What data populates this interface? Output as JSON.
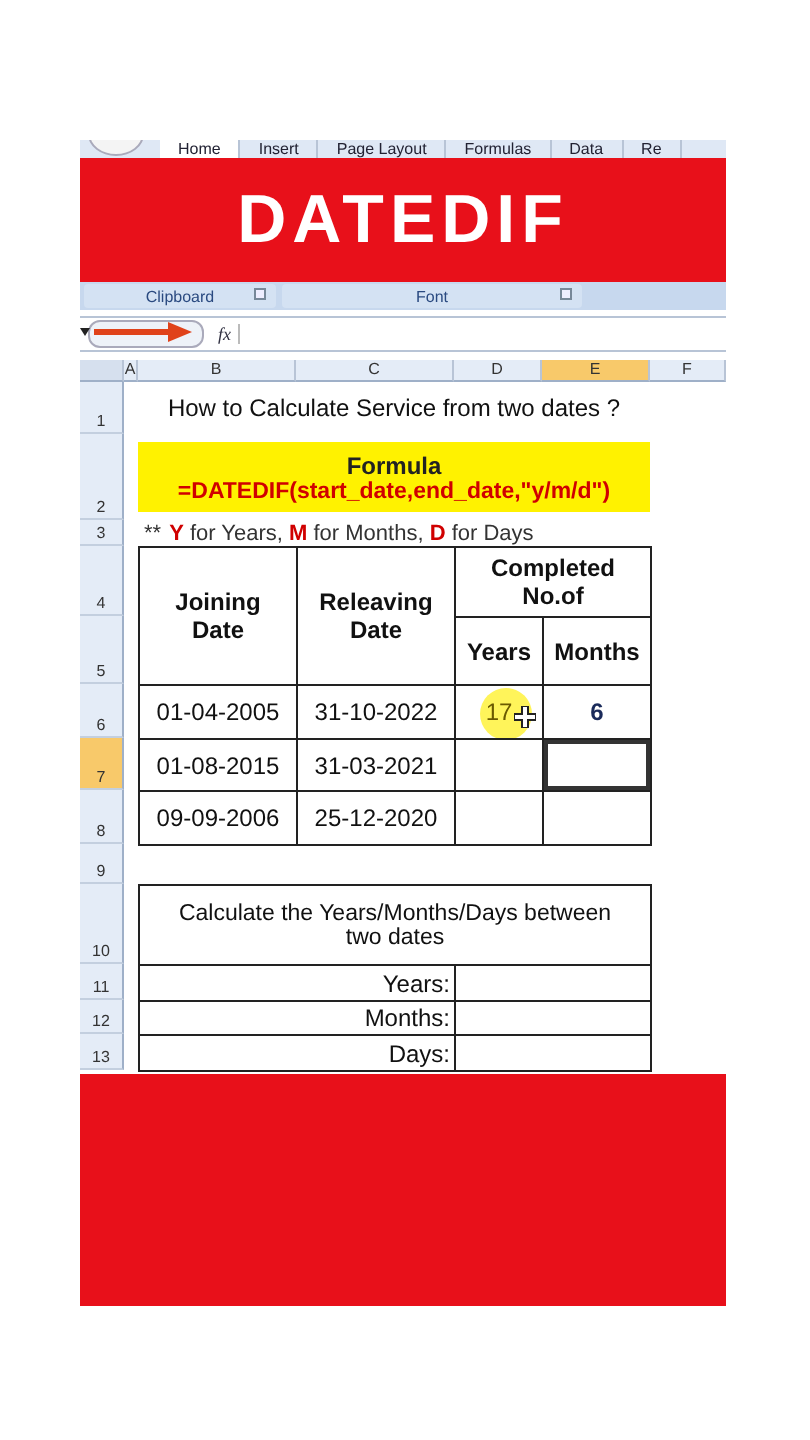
{
  "ribbon_tabs": [
    {
      "label": "Home",
      "selected": true
    },
    {
      "label": "Insert",
      "selected": false
    },
    {
      "label": "Page Layout",
      "selected": false
    },
    {
      "label": "Formulas",
      "selected": false
    },
    {
      "label": "Data",
      "selected": false
    },
    {
      "label": "Re",
      "selected": false
    }
  ],
  "banner": {
    "title": "DATEDIF"
  },
  "ribbon_groups": [
    "Clipboard",
    "Font"
  ],
  "formula_bar": {
    "function_label": "fx"
  },
  "columns": [
    {
      "label": "A",
      "selected": false
    },
    {
      "label": "B",
      "selected": false
    },
    {
      "label": "C",
      "selected": false
    },
    {
      "label": "D",
      "selected": false
    },
    {
      "label": "E",
      "selected": true
    },
    {
      "label": "F",
      "selected": false
    }
  ],
  "rows": [
    {
      "label": "1",
      "selected": false
    },
    {
      "label": "2",
      "selected": false
    },
    {
      "label": "3",
      "selected": false
    },
    {
      "label": "4",
      "selected": false
    },
    {
      "label": "5",
      "selected": false
    },
    {
      "label": "6",
      "selected": false
    },
    {
      "label": "7",
      "selected": true
    },
    {
      "label": "8",
      "selected": false
    },
    {
      "label": "9",
      "selected": false
    },
    {
      "label": "10",
      "selected": false
    },
    {
      "label": "11",
      "selected": false
    },
    {
      "label": "12",
      "selected": false
    },
    {
      "label": "13",
      "selected": false
    }
  ],
  "sheet": {
    "title": "How to Calculate Service from two dates ?",
    "formula_heading": "Formula",
    "formula": "=DATEDIF(start_date,end_date,\"y/m/d\")",
    "note_mark": "**",
    "legend": "**Y** for Years, **M** for Months, **D** for Days",
    "headers": {
      "joining": "Joining Date",
      "releaving": "Releaving Date",
      "completed": "Completed No.of",
      "years": "Years",
      "months": "Months"
    },
    "data_rows": [
      {
        "joining": "01-04-2005",
        "releaving": "31-10-2022",
        "years": "17",
        "months": "6",
        "months_selected": false
      },
      {
        "joining": "01-08-2015",
        "releaving": "31-03-2021",
        "months_selected": true
      },
      {
        "joining": "09-09-2006",
        "releaving": "25-12-2020",
        "months_selected": false
      }
    ],
    "summary": {
      "heading": "Calculate the Years/Months/Days between two dates",
      "labels": [
        "Years:",
        "Months:",
        "Days:"
      ]
    }
  }
}
